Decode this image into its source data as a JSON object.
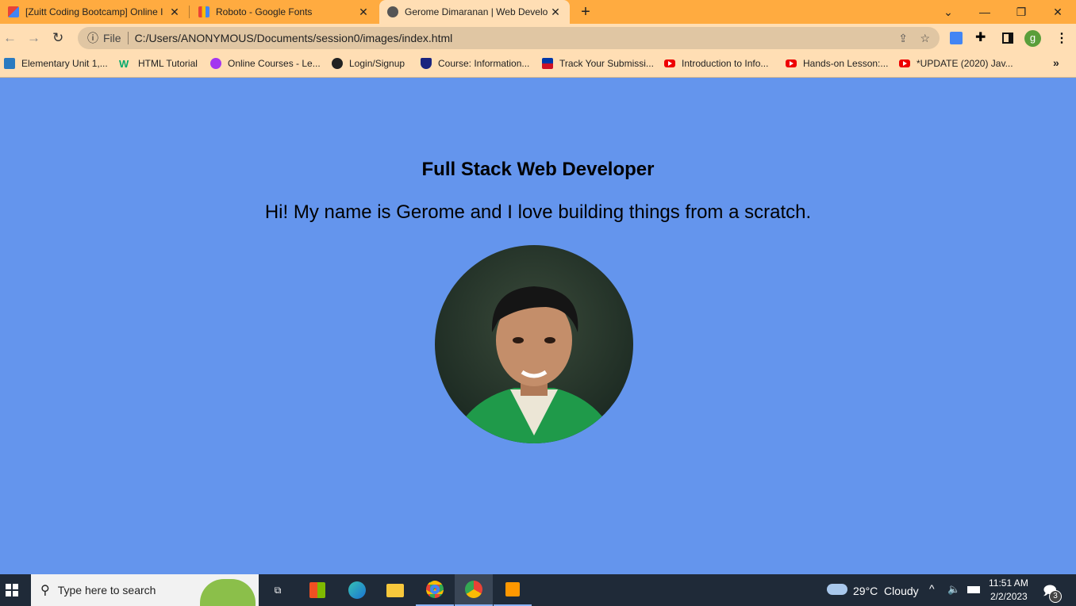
{
  "browser": {
    "tabs": [
      {
        "title": "[Zuitt Coding Bootcamp] Online I",
        "icon": "gmail-icon"
      },
      {
        "title": "Roboto - Google Fonts",
        "icon": "google-fonts-icon"
      },
      {
        "title": "Gerome Dimaranan | Web Develo",
        "icon": "globe-icon",
        "active": true
      }
    ],
    "new_tab": "+",
    "address": {
      "scheme_label": "File",
      "url": "C:/Users/ANONYMOUS/Documents/session0/images/index.html"
    },
    "profile_initial": "g",
    "bookmarks": [
      {
        "label": "Elementary Unit 1,...",
        "icon": "el-icon"
      },
      {
        "label": "HTML Tutorial",
        "icon": "w3schools-icon"
      },
      {
        "label": "Online Courses - Le...",
        "icon": "udemy-icon"
      },
      {
        "label": "Login/Signup",
        "icon": "globe-icon"
      },
      {
        "label": "Course: Information...",
        "icon": "shield-icon"
      },
      {
        "label": "Track Your Submissi...",
        "icon": "flag-icon"
      },
      {
        "label": "Introduction to Info...",
        "icon": "youtube-icon"
      },
      {
        "label": "Hands-on Lesson:...",
        "icon": "youtube-icon"
      },
      {
        "label": "*UPDATE (2020) Jav...",
        "icon": "youtube-icon"
      }
    ],
    "more_bookmarks": "»"
  },
  "page": {
    "heading": "Full Stack Web Developer",
    "intro": "Hi! My name is Gerome and I love building things from a scratch."
  },
  "taskbar": {
    "search_placeholder": "Type here to search",
    "weather": "29°C  Cloudy",
    "time": "11:51 AM",
    "date": "2/2/2023",
    "notifications": "3"
  },
  "colors": {
    "tabbar": "#ffab40",
    "toolbar": "#ffdeb4",
    "page_bg": "#6495ed",
    "taskbar": "#1f2a38"
  }
}
